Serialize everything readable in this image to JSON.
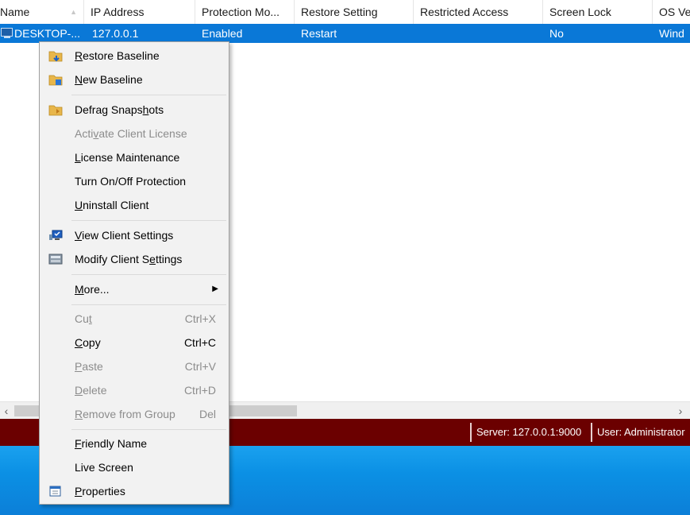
{
  "table": {
    "columns": [
      "Name",
      "IP Address",
      "Protection Mo...",
      "Restore Setting",
      "Restricted Access",
      "Screen Lock",
      "OS Ve"
    ],
    "row": {
      "name": "DESKTOP-...",
      "ip": "127.0.0.1",
      "protection": "Enabled",
      "restore": "Restart",
      "restricted": "",
      "screen_lock": "No",
      "os": "Wind"
    },
    "selected_color": "#0a78d7"
  },
  "statusbar": {
    "server": "Server: 127.0.0.1:9000",
    "user": "User: Administrator",
    "color": "#6b0000"
  },
  "menu": {
    "restore_baseline": {
      "pre": "",
      "u": "R",
      "post": "estore Baseline"
    },
    "new_baseline": {
      "pre": "",
      "u": "N",
      "post": "ew Baseline"
    },
    "defrag": {
      "pre": "Defrag Snaps",
      "u": "h",
      "post": "ots"
    },
    "activate": {
      "pre": "Acti",
      "u": "v",
      "post": "ate Client License"
    },
    "license": {
      "pre": "",
      "u": "L",
      "post": "icense Maintenance"
    },
    "turn": {
      "pre": "Turn On/Off Protection",
      "u": "",
      "post": ""
    },
    "uninstall": {
      "pre": "",
      "u": "U",
      "post": "ninstall Client"
    },
    "view": {
      "pre": "",
      "u": "V",
      "post": "iew Client Settings"
    },
    "modify": {
      "pre": "Modify Client S",
      "u": "e",
      "post": "ttings"
    },
    "more": {
      "pre": "",
      "u": "M",
      "post": "ore..."
    },
    "cut": {
      "pre": "Cu",
      "u": "t",
      "post": "",
      "shortcut": "Ctrl+X"
    },
    "copy": {
      "pre": "",
      "u": "C",
      "post": "opy",
      "shortcut": "Ctrl+C"
    },
    "paste": {
      "pre": "",
      "u": "P",
      "post": "aste",
      "shortcut": "Ctrl+V"
    },
    "delete": {
      "pre": "",
      "u": "D",
      "post": "elete",
      "shortcut": "Ctrl+D"
    },
    "remove": {
      "pre": "",
      "u": "R",
      "post": "emove from Group",
      "shortcut": "Del"
    },
    "friendly": {
      "pre": "",
      "u": "F",
      "post": "riendly Name"
    },
    "live": {
      "pre": "Live Screen",
      "u": "",
      "post": ""
    },
    "properties": {
      "pre": "",
      "u": "P",
      "post": "roperties"
    }
  },
  "icons": {
    "restore_baseline": "restore-baseline-icon",
    "new_baseline": "new-baseline-icon",
    "defrag": "defrag-icon",
    "view": "view-settings-icon",
    "modify": "modify-settings-icon",
    "properties": "properties-icon",
    "submenu": "chevron-right-icon",
    "computer": "computer-icon"
  }
}
